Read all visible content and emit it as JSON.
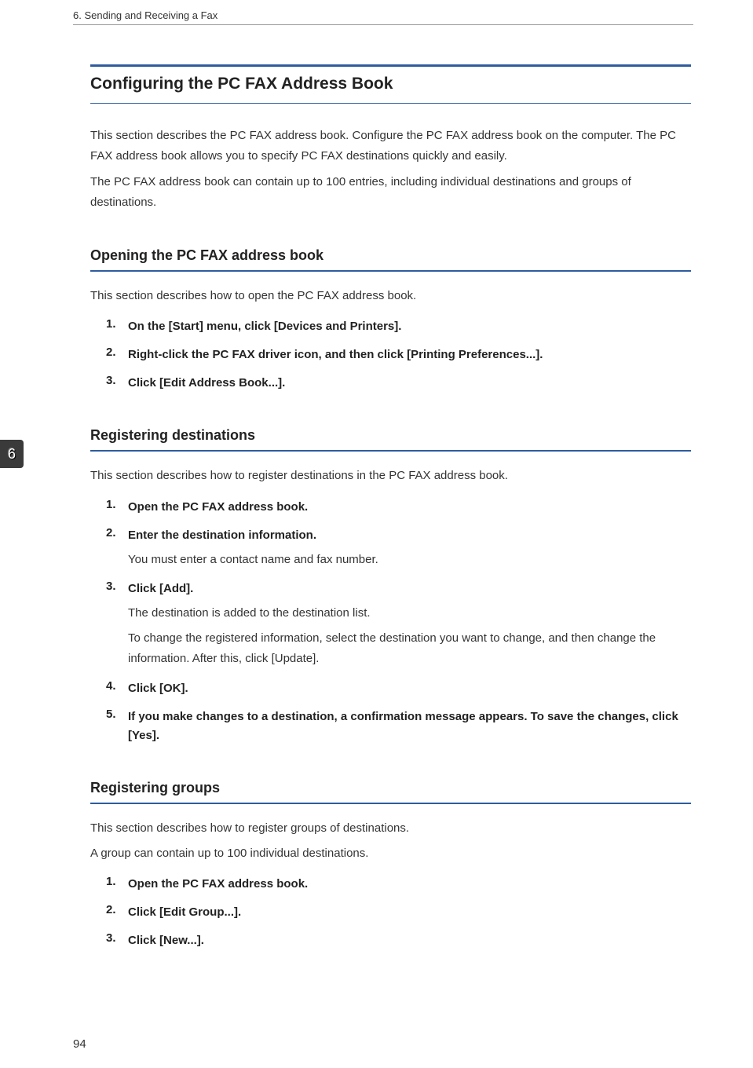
{
  "header": {
    "chapterLabel": "6. Sending and Receiving a Fax"
  },
  "chapterTab": "6",
  "pageNumber": "94",
  "mainTitle": "Configuring the PC FAX Address Book",
  "intro": {
    "p1": "This section describes the PC FAX address book. Configure the PC FAX address book on the computer. The PC FAX address book allows you to specify PC FAX destinations quickly and easily.",
    "p2": "The PC FAX address book can contain up to 100 entries, including individual destinations and groups of destinations."
  },
  "sections": [
    {
      "title": "Opening the PC FAX address book",
      "intro": "This section describes how to open the PC FAX address book.",
      "steps": [
        {
          "num": "1.",
          "label": "On the [Start] menu, click [Devices and Printers]."
        },
        {
          "num": "2.",
          "label": "Right-click the PC FAX driver icon, and then click [Printing Preferences...]."
        },
        {
          "num": "3.",
          "label": "Click [Edit Address Book...]."
        }
      ]
    },
    {
      "title": "Registering destinations",
      "intro": "This section describes how to register destinations in the PC FAX address book.",
      "steps": [
        {
          "num": "1.",
          "label": "Open the PC FAX address book."
        },
        {
          "num": "2.",
          "label": "Enter the destination information.",
          "desc": [
            "You must enter a contact name and fax number."
          ]
        },
        {
          "num": "3.",
          "label": "Click [Add].",
          "desc": [
            "The destination is added to the destination list.",
            "To change the registered information, select the destination you want to change, and then change the information. After this, click [Update]."
          ]
        },
        {
          "num": "4.",
          "label": "Click [OK]."
        },
        {
          "num": "5.",
          "label": "If you make changes to a destination, a confirmation message appears. To save the changes, click [Yes]."
        }
      ]
    },
    {
      "title": "Registering groups",
      "intro": "This section describes how to register groups of destinations.",
      "intro2": "A group can contain up to 100 individual destinations.",
      "steps": [
        {
          "num": "1.",
          "label": "Open the PC FAX address book."
        },
        {
          "num": "2.",
          "label": "Click [Edit Group...]."
        },
        {
          "num": "3.",
          "label": "Click [New...]."
        }
      ]
    }
  ]
}
